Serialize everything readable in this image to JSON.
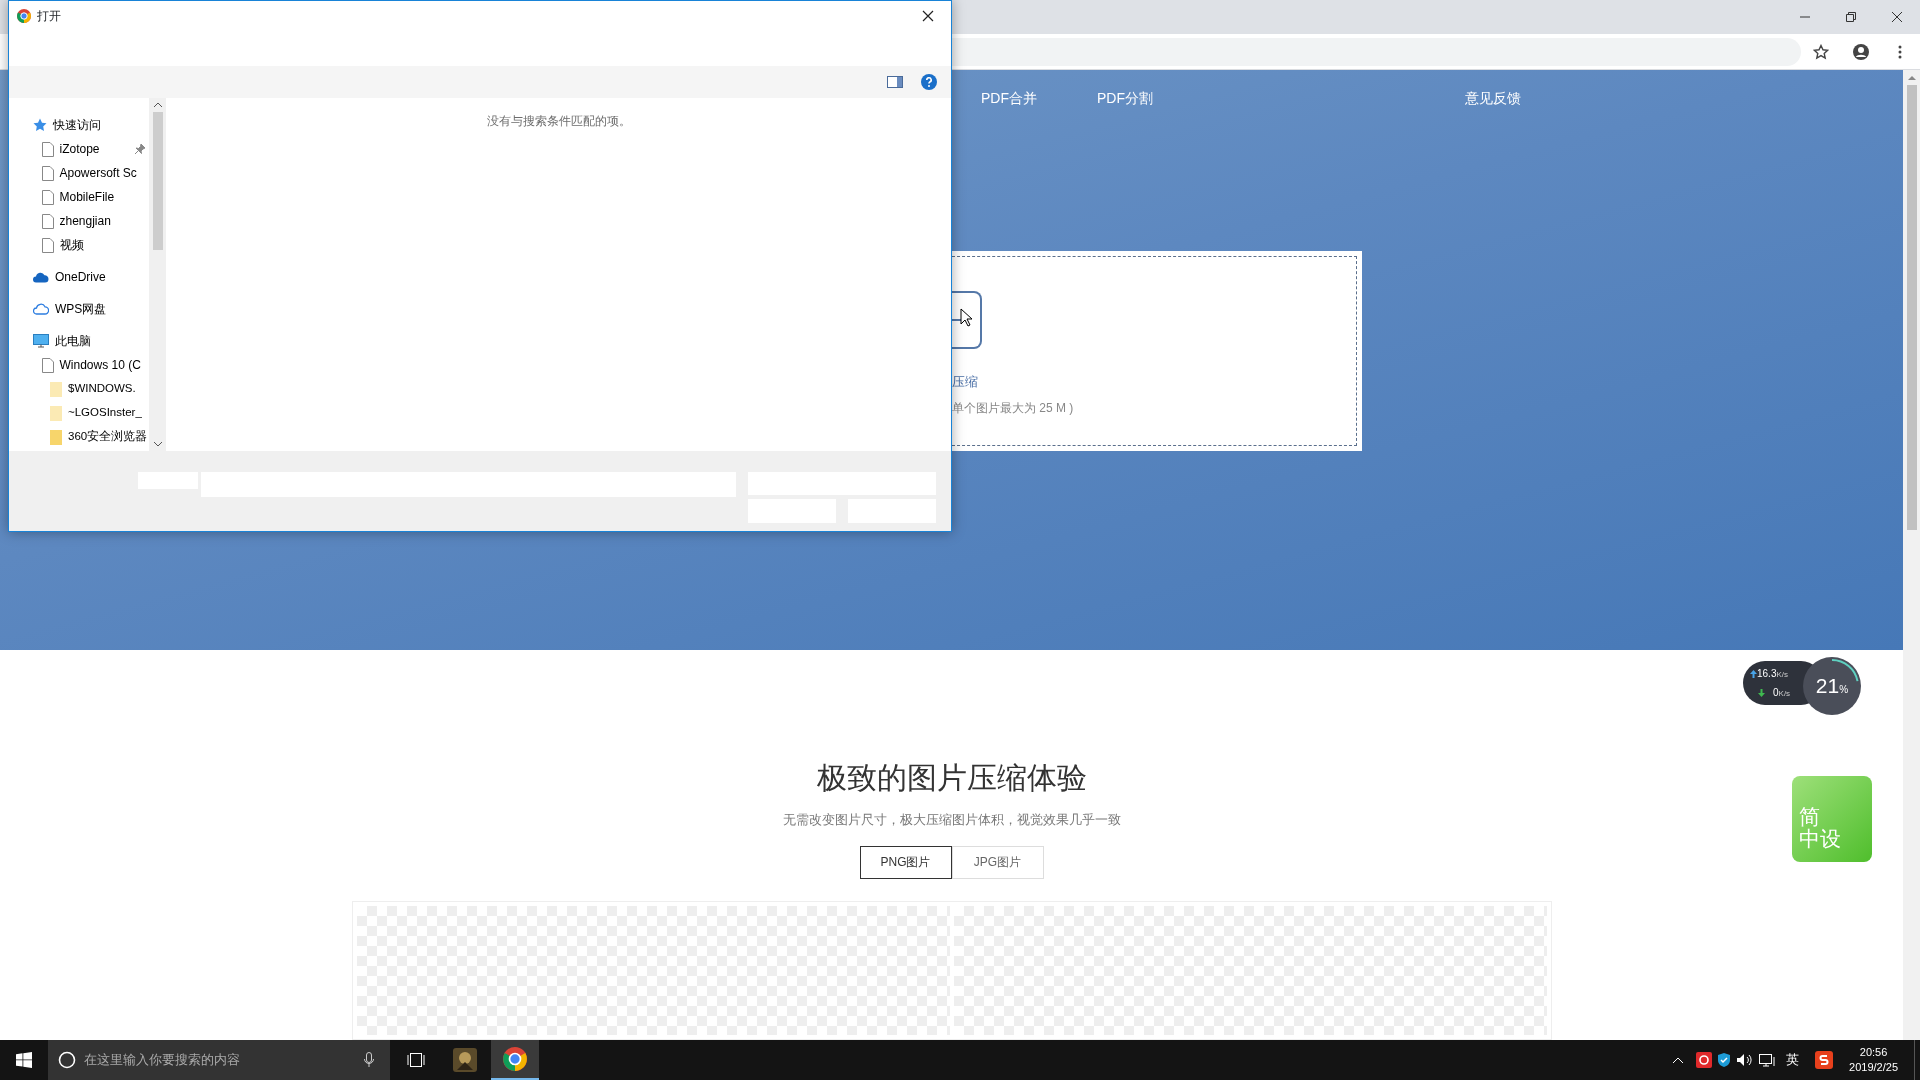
{
  "dialog": {
    "title": "打开",
    "nav": [
      {
        "label": "快速访问",
        "kind": "quick",
        "children": [
          {
            "label": "iZotope",
            "kind": "file",
            "pinned": true
          },
          {
            "label": "Apowersoft Sc",
            "kind": "file",
            "pinned": false
          },
          {
            "label": "MobileFile",
            "kind": "file",
            "pinned": false
          },
          {
            "label": "zhengjian",
            "kind": "file",
            "pinned": false
          },
          {
            "label": "视频",
            "kind": "file",
            "pinned": false
          }
        ]
      },
      {
        "label": "OneDrive",
        "kind": "onedrive"
      },
      {
        "label": "WPS网盘",
        "kind": "wps"
      },
      {
        "label": "此电脑",
        "kind": "pc",
        "children": [
          {
            "label": "Windows 10 (C",
            "kind": "file",
            "children": [
              {
                "label": "$WINDOWS.",
                "kind": "folder-light"
              },
              {
                "label": "~LGOSInster_",
                "kind": "folder-light"
              },
              {
                "label": "360安全浏览器",
                "kind": "folder"
              }
            ]
          }
        ]
      }
    ],
    "empty_message": "没有与搜索条件匹配的项。"
  },
  "nav": [
    "PDF合并",
    "PDF分割",
    "意见反馈"
  ],
  "upload": {
    "label": "压缩",
    "note": "单个图片最大为 25 M )"
  },
  "section": {
    "heading": "极致的图片压缩体验",
    "subtitle": "无需改变图片尺寸，极大压缩图片体积，视觉效果几乎一致",
    "tabs": [
      {
        "label": "PNG图片",
        "selected": true
      },
      {
        "label": "JPG图片",
        "selected": false
      }
    ]
  },
  "net_monitor": {
    "upload": "16.3",
    "upload_unit": "K/s",
    "download": "0",
    "download_unit": "K/s",
    "percent": "21",
    "percent_unit": "%"
  },
  "tile": {
    "lines": [
      "简",
      "中设"
    ]
  },
  "taskbar": {
    "search_placeholder": "在这里输入你要搜索的内容",
    "apps": [
      {
        "kind": "game",
        "selected": false
      },
      {
        "kind": "chrome",
        "selected": true
      }
    ],
    "ime": "英",
    "time": "20:56",
    "date": "2019/2/25"
  }
}
